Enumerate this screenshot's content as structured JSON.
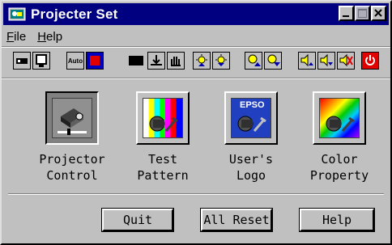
{
  "window": {
    "title": "Projecter Set"
  },
  "menu": {
    "items": [
      "File",
      "Help"
    ]
  },
  "toolbar": {
    "auto_label": "Auto",
    "icons": [
      "display-mode-icon",
      "auto-setup-icon",
      "image-adjust-icon",
      "brightness-icon",
      "keystone-icon",
      "volume-icon",
      "power-icon"
    ]
  },
  "tiles": [
    {
      "line1": "Projector",
      "line2": "Control",
      "selected": true
    },
    {
      "line1": "Test",
      "line2": "Pattern",
      "selected": false
    },
    {
      "line1": "User's",
      "line2": "Logo",
      "logo_text": "EPSO",
      "selected": false
    },
    {
      "line1": "Color",
      "line2": "Property",
      "selected": false
    }
  ],
  "buttons": {
    "quit": "Quit",
    "all_reset": "All Reset",
    "help": "Help"
  },
  "colors": {
    "titlebar": "#000080",
    "face": "#c0c0c0",
    "power": "#e00000"
  }
}
